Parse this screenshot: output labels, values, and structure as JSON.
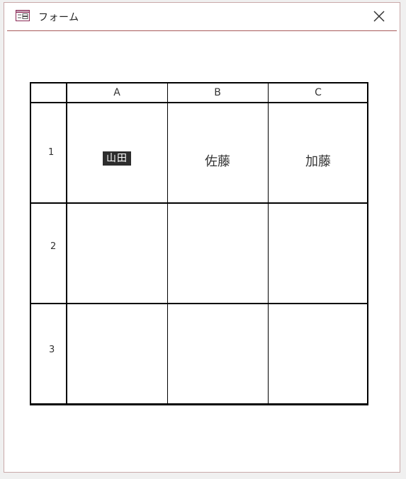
{
  "window": {
    "title": "フォーム"
  },
  "table": {
    "columns": [
      "A",
      "B",
      "C"
    ],
    "rows": [
      {
        "num": "1",
        "cells": [
          "山田",
          "佐藤",
          "加藤"
        ],
        "selected_col": 0
      },
      {
        "num": "2",
        "cells": [
          "",
          "",
          ""
        ]
      },
      {
        "num": "3",
        "cells": [
          "",
          "",
          ""
        ]
      }
    ]
  },
  "colors": {
    "selection_bg": "#2d2d2d",
    "title_separator": "#a85a5a",
    "window_border": "#c9a9a9"
  }
}
